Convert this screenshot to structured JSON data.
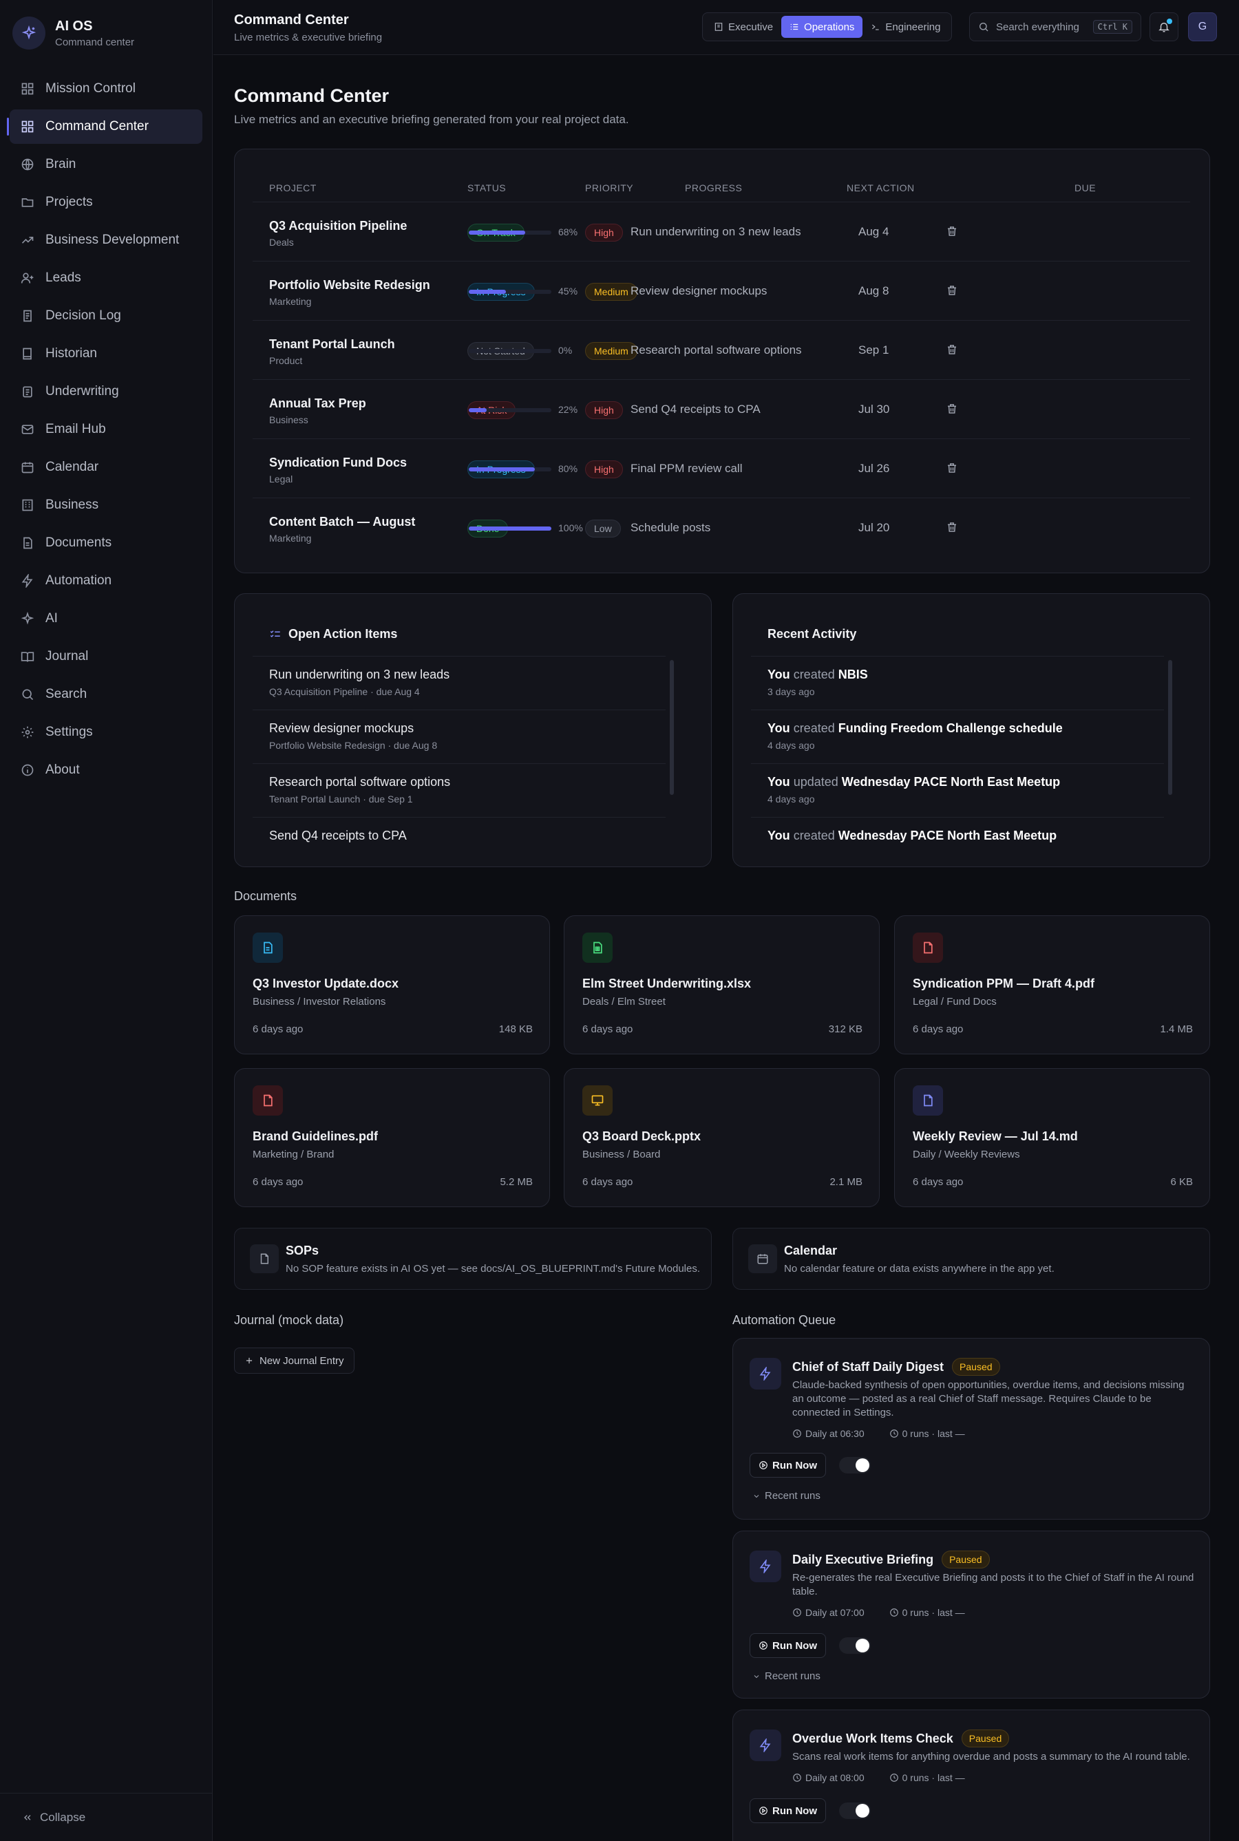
{
  "app": {
    "name": "AI OS",
    "subtitle": "Command center"
  },
  "sidebar": {
    "items": [
      {
        "label": "Mission Control",
        "icon": "grid-icon"
      },
      {
        "label": "Command Center",
        "icon": "grid-icon",
        "active": true
      },
      {
        "label": "Brain",
        "icon": "globe-icon"
      },
      {
        "label": "Projects",
        "icon": "folder-icon"
      },
      {
        "label": "Business Development",
        "icon": "trending-up-icon"
      },
      {
        "label": "Leads",
        "icon": "user-plus-icon"
      },
      {
        "label": "Decision Log",
        "icon": "scroll-icon"
      },
      {
        "label": "Historian",
        "icon": "book-icon"
      },
      {
        "label": "Underwriting",
        "icon": "clipboard-icon"
      },
      {
        "label": "Email Hub",
        "icon": "mail-icon"
      },
      {
        "label": "Calendar",
        "icon": "calendar-icon"
      },
      {
        "label": "Business",
        "icon": "building-icon"
      },
      {
        "label": "Documents",
        "icon": "file-icon"
      },
      {
        "label": "Automation",
        "icon": "zap-icon"
      },
      {
        "label": "AI",
        "icon": "sparkles-icon"
      },
      {
        "label": "Journal",
        "icon": "book-open-icon"
      },
      {
        "label": "Search",
        "icon": "search-icon"
      },
      {
        "label": "Settings",
        "icon": "gear-icon"
      },
      {
        "label": "About",
        "icon": "info-icon"
      }
    ],
    "collapse_label": "Collapse"
  },
  "topbar": {
    "title": "Command Center",
    "subtitle": "Live metrics & executive briefing",
    "views": [
      {
        "label": "Executive",
        "icon": "building-icon"
      },
      {
        "label": "Operations",
        "icon": "list-icon",
        "active": true
      },
      {
        "label": "Engineering",
        "icon": "terminal-icon"
      }
    ],
    "search": {
      "placeholder": "Search everything",
      "shortcut": "Ctrl K"
    },
    "avatar_initial": "G"
  },
  "page": {
    "title": "Command Center",
    "subtitle": "Live metrics and an executive briefing generated from your real project data."
  },
  "projects_table": {
    "columns": [
      "PROJECT",
      "STATUS",
      "PRIORITY",
      "PROGRESS",
      "NEXT ACTION",
      "DUE"
    ],
    "rows": [
      {
        "name": "Q3 Acquisition Pipeline",
        "category": "Deals",
        "status": "On Track",
        "priority": "High",
        "progress": 68,
        "progress_label": "68%",
        "next_action": "Run underwriting on 3 new leads",
        "due": "Aug 4"
      },
      {
        "name": "Portfolio Website Redesign",
        "category": "Marketing",
        "status": "In Progress",
        "priority": "Medium",
        "progress": 45,
        "progress_label": "45%",
        "next_action": "Review designer mockups",
        "due": "Aug 8"
      },
      {
        "name": "Tenant Portal Launch",
        "category": "Product",
        "status": "Not Started",
        "priority": "Medium",
        "progress": 0,
        "progress_label": "0%",
        "next_action": "Research portal software options",
        "due": "Sep 1"
      },
      {
        "name": "Annual Tax Prep",
        "category": "Business",
        "status": "At Risk",
        "priority": "High",
        "progress": 22,
        "progress_label": "22%",
        "next_action": "Send Q4 receipts to CPA",
        "due": "Jul 30"
      },
      {
        "name": "Syndication Fund Docs",
        "category": "Legal",
        "status": "In Progress",
        "priority": "High",
        "progress": 80,
        "progress_label": "80%",
        "next_action": "Final PPM review call",
        "due": "Jul 26"
      },
      {
        "name": "Content Batch — August",
        "category": "Marketing",
        "status": "Done",
        "priority": "Low",
        "progress": 100,
        "progress_label": "100%",
        "next_action": "Schedule posts",
        "due": "Jul 20"
      }
    ]
  },
  "action_items": {
    "title": "Open Action Items",
    "items": [
      {
        "title": "Run underwriting on 3 new leads",
        "sub": "Q3 Acquisition Pipeline · due Aug 4"
      },
      {
        "title": "Review designer mockups",
        "sub": "Portfolio Website Redesign · due Aug 8"
      },
      {
        "title": "Research portal software options",
        "sub": "Tenant Portal Launch · due Sep 1"
      },
      {
        "title": "Send Q4 receipts to CPA",
        "sub": ""
      }
    ]
  },
  "recent_activity": {
    "title": "Recent Activity",
    "items": [
      {
        "actor": "You",
        "verb": "created",
        "object": "NBIS",
        "time": "3 days ago"
      },
      {
        "actor": "You",
        "verb": "created",
        "object": "Funding Freedom Challenge schedule",
        "time": "4 days ago"
      },
      {
        "actor": "You",
        "verb": "updated",
        "object": "Wednesday PACE North East Meetup",
        "time": "4 days ago"
      },
      {
        "actor": "You",
        "verb": "created",
        "object": "Wednesday PACE North East Meetup",
        "time": ""
      }
    ]
  },
  "documents": {
    "title": "Documents",
    "items": [
      {
        "name": "Q3 Investor Update.docx",
        "path": "Business / Investor Relations",
        "age": "6 days ago",
        "size": "148 KB",
        "icon": "doc-icon",
        "color": "#38bdf8"
      },
      {
        "name": "Elm Street Underwriting.xlsx",
        "path": "Deals / Elm Street",
        "age": "6 days ago",
        "size": "312 KB",
        "icon": "sheet-icon",
        "color": "#4ade80"
      },
      {
        "name": "Syndication PPM — Draft 4.pdf",
        "path": "Legal / Fund Docs",
        "age": "6 days ago",
        "size": "1.4 MB",
        "icon": "pdf-icon",
        "color": "#f87171"
      },
      {
        "name": "Brand Guidelines.pdf",
        "path": "Marketing / Brand",
        "age": "6 days ago",
        "size": "5.2 MB",
        "icon": "pdf-icon",
        "color": "#f87171"
      },
      {
        "name": "Q3 Board Deck.pptx",
        "path": "Business / Board",
        "age": "6 days ago",
        "size": "2.1 MB",
        "icon": "presentation-icon",
        "color": "#fbbf24"
      },
      {
        "name": "Weekly Review — Jul 14.md",
        "path": "Daily / Weekly Reviews",
        "age": "6 days ago",
        "size": "6 KB",
        "icon": "markdown-icon",
        "color": "#818cf8"
      }
    ]
  },
  "info_cards": {
    "sops": {
      "title": "SOPs",
      "text": "No SOP feature exists in AI OS yet — see docs/AI_OS_BLUEPRINT.md's Future Modules."
    },
    "calendar": {
      "title": "Calendar",
      "text": "No calendar feature or data exists anywhere in the app yet."
    }
  },
  "journal": {
    "title": "Journal (mock data)",
    "new_entry_label": "New Journal Entry"
  },
  "automation": {
    "title": "Automation Queue",
    "run_label": "Run Now",
    "recent_label": "Recent runs",
    "items": [
      {
        "name": "Chief of Staff Daily Digest",
        "state": "Paused",
        "description": "Claude-backed synthesis of open opportunities, overdue items, and decisions missing an outcome — posted as a real Chief of Staff message. Requires Claude to be connected in Settings.",
        "schedule": "Daily at 06:30",
        "runs": "0 runs · last —",
        "enabled": true
      },
      {
        "name": "Daily Executive Briefing",
        "state": "Paused",
        "description": "Re-generates the real Executive Briefing and posts it to the Chief of Staff in the AI round table.",
        "schedule": "Daily at 07:00",
        "runs": "0 runs · last —",
        "enabled": true
      },
      {
        "name": "Overdue Work Items Check",
        "state": "Paused",
        "description": "Scans real work items for anything overdue and posts a summary to the AI round table.",
        "schedule": "Daily at 08:00",
        "runs": "0 runs · last —",
        "enabled": true
      }
    ]
  },
  "colors": {
    "accent": "#6366f1",
    "background": "#0c0d12",
    "panel": "#13141b"
  }
}
